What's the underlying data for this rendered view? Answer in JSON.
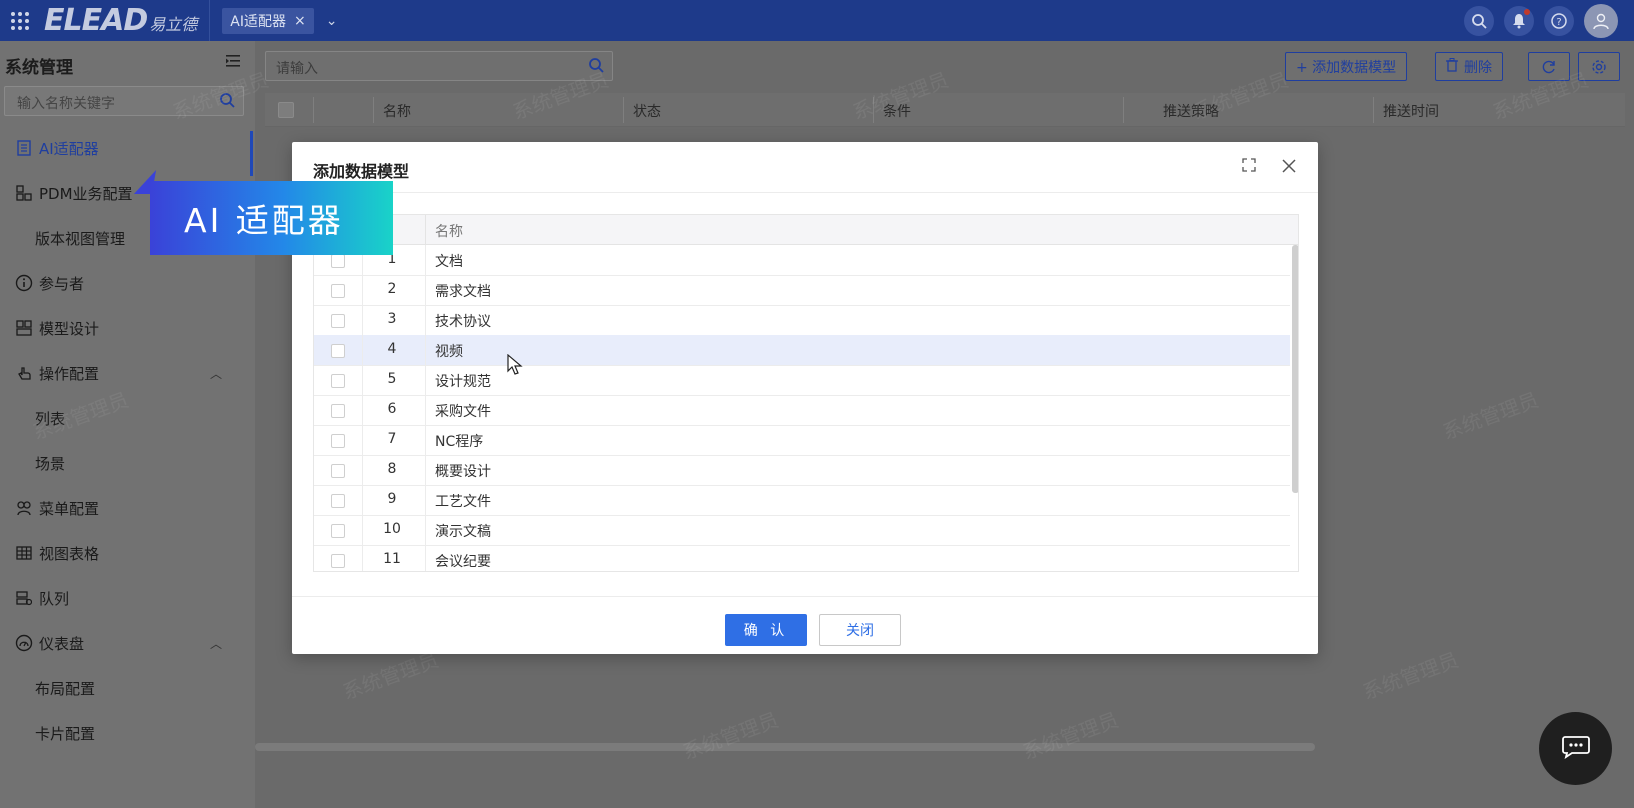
{
  "topbar": {
    "logo_text": "ELEAD",
    "logo_subtext": "易立德",
    "tab_label": "AI适配器",
    "tab_close": "×",
    "dropdown": "⌄"
  },
  "sidebar": {
    "title": "系统管理",
    "search_placeholder": "输入名称关键字",
    "items": [
      {
        "label": "AI适配器",
        "icon": "list-icon"
      },
      {
        "label": "PDM业务配置",
        "icon": "org-icon"
      },
      {
        "label": "版本视图管理",
        "icon": ""
      },
      {
        "label": "参与者",
        "icon": "info-icon"
      },
      {
        "label": "模型设计",
        "icon": "model-icon"
      },
      {
        "label": "操作配置",
        "icon": "hand-icon"
      },
      {
        "label": "列表",
        "icon": ""
      },
      {
        "label": "场景",
        "icon": ""
      },
      {
        "label": "菜单配置",
        "icon": "menu-config-icon"
      },
      {
        "label": "视图表格",
        "icon": "table-icon"
      },
      {
        "label": "队列",
        "icon": "queue-icon"
      },
      {
        "label": "仪表盘",
        "icon": "gauge-icon"
      },
      {
        "label": "布局配置",
        "icon": ""
      },
      {
        "label": "卡片配置",
        "icon": ""
      }
    ]
  },
  "main": {
    "search_placeholder": "请输入",
    "add_button": "+ 添加数据模型",
    "delete_button": "删除",
    "columns": [
      "名称",
      "状态",
      "条件",
      "推送策略",
      "推送时间"
    ]
  },
  "watermark_text": "系统管理员",
  "modal": {
    "title": "添加数据模型",
    "column_name": "名称",
    "rows": [
      {
        "idx": "1",
        "name": "文档"
      },
      {
        "idx": "2",
        "name": "需求文档"
      },
      {
        "idx": "3",
        "name": "技术协议"
      },
      {
        "idx": "4",
        "name": "视频"
      },
      {
        "idx": "5",
        "name": "设计规范"
      },
      {
        "idx": "6",
        "name": "采购文件"
      },
      {
        "idx": "7",
        "name": "NC程序"
      },
      {
        "idx": "8",
        "name": "概要设计"
      },
      {
        "idx": "9",
        "name": "工艺文件"
      },
      {
        "idx": "10",
        "name": "演示文稿"
      },
      {
        "idx": "11",
        "name": "会议纪要"
      }
    ],
    "hovered_row_index": 3,
    "confirm_label": "确 认",
    "close_label": "关闭"
  },
  "callout": {
    "text": "AI 适配器"
  },
  "colors": {
    "topbar": "#1e3a8a",
    "primary": "#2f6fe5",
    "active_menu": "#1f3e9f"
  }
}
